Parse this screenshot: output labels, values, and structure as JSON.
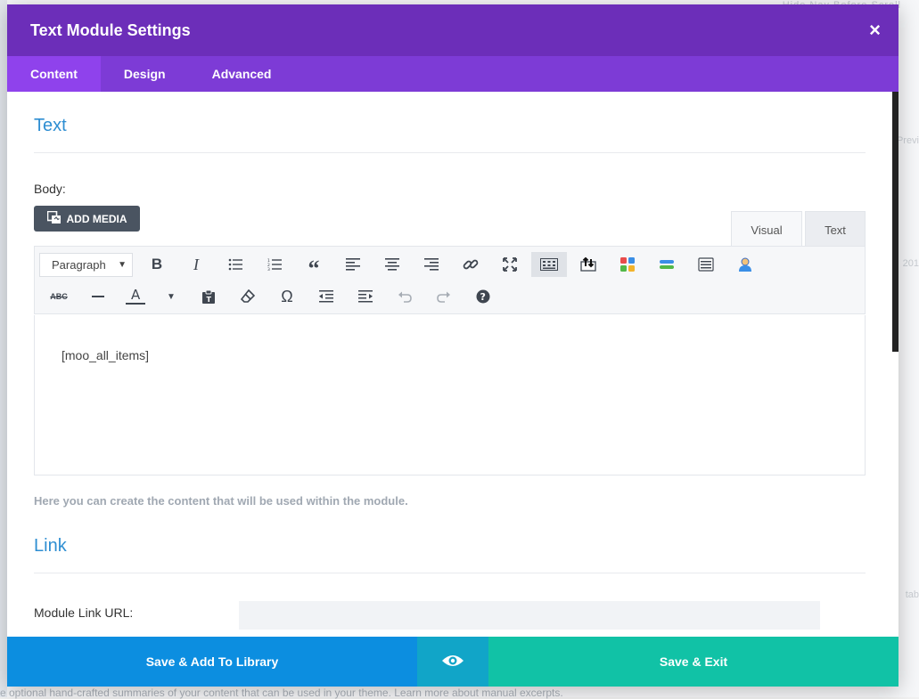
{
  "modal": {
    "title": "Text Module Settings",
    "close_icon": "×",
    "tabs": [
      {
        "label": "Content",
        "active": true
      },
      {
        "label": "Design",
        "active": false
      },
      {
        "label": "Advanced",
        "active": false
      }
    ]
  },
  "text_section": {
    "title": "Text",
    "body_label": "Body:",
    "add_media_label": "ADD MEDIA",
    "editor_tabs": [
      {
        "label": "Visual",
        "active": true
      },
      {
        "label": "Text",
        "active": false
      }
    ],
    "format_value": "Paragraph",
    "content": "[moo_all_items]",
    "help": "Here you can create the content that will be used within the module."
  },
  "link_section": {
    "title": "Link",
    "url_label": "Module Link URL:",
    "url_value": ""
  },
  "footer": {
    "library_label": "Save & Add To Library",
    "exit_label": "Save & Exit"
  },
  "background": {
    "top_text": "Hide  Nav  Before  Scroll",
    "right_items": [
      "Previ",
      "201",
      "tab"
    ],
    "bottom_text": "e optional hand-crafted summaries of your content that can be used in your theme. Learn more about manual excerpts."
  },
  "colors": {
    "header": "#6c2eb9",
    "tabs": "#7d3bd6",
    "accent": "#2e8ed2",
    "library_button": "#0c8ee0",
    "exit_button": "#11c2a6"
  }
}
